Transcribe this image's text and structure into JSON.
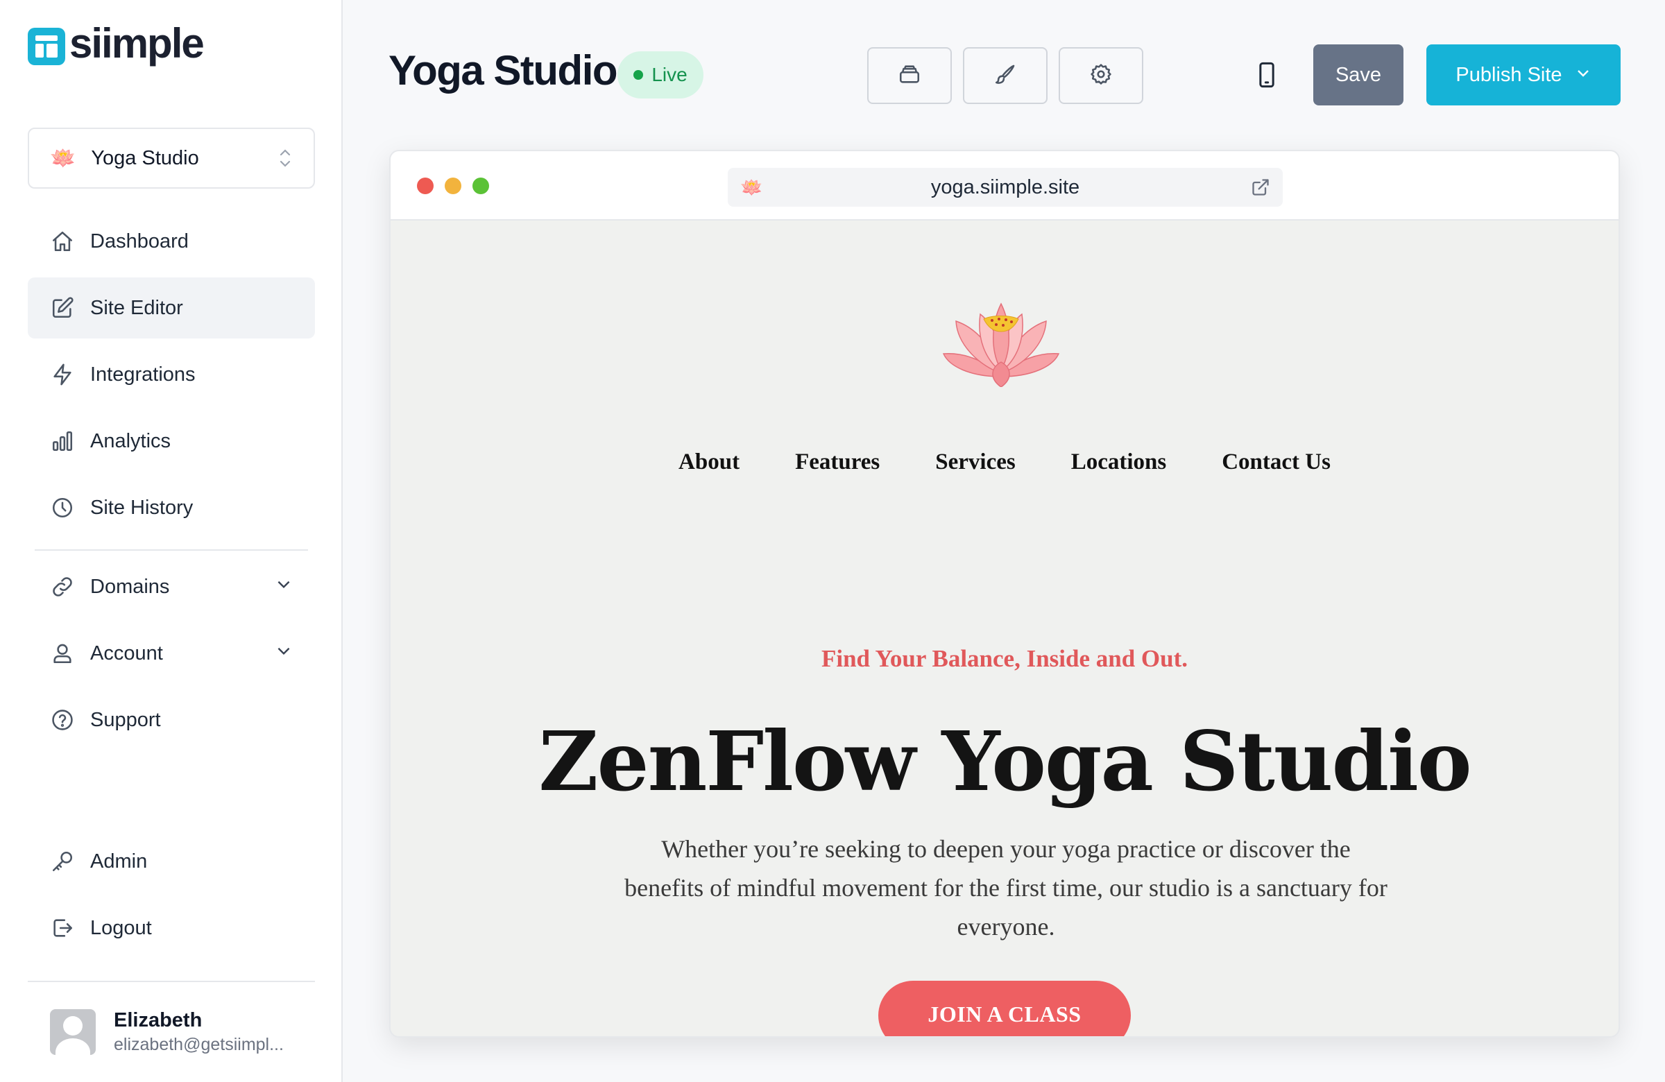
{
  "brand": {
    "name": "siimple",
    "color": "#1ab3d6"
  },
  "site_selector": {
    "icon": "lotus-icon",
    "name": "Yoga Studio"
  },
  "sidebar": {
    "items": [
      {
        "label": "Dashboard",
        "icon": "home-icon"
      },
      {
        "label": "Site Editor",
        "icon": "edit-icon",
        "active": true
      },
      {
        "label": "Integrations",
        "icon": "bolt-icon"
      },
      {
        "label": "Analytics",
        "icon": "bar-chart-icon"
      },
      {
        "label": "Site History",
        "icon": "clock-icon"
      }
    ],
    "groups": [
      {
        "label": "Domains",
        "icon": "link-icon"
      },
      {
        "label": "Account",
        "icon": "user-icon"
      },
      {
        "label": "Support",
        "icon": "help-icon"
      }
    ],
    "bottom": [
      {
        "label": "Admin",
        "icon": "key-icon"
      },
      {
        "label": "Logout",
        "icon": "logout-icon"
      }
    ]
  },
  "user": {
    "name": "Elizabeth",
    "email": "elizabeth@getsiimpl..."
  },
  "header": {
    "title": "Yoga Studio",
    "status": "Live",
    "save_label": "Save",
    "publish_label": "Publish Site"
  },
  "preview": {
    "url": "yoga.siimple.site",
    "nav": [
      "About",
      "Features",
      "Services",
      "Locations",
      "Contact Us"
    ],
    "tagline": "Find Your Balance, Inside and Out.",
    "title": "ZenFlow Yoga Studio",
    "subtitle": "Whether you’re seeking to deepen your yoga practice or discover the benefits of mindful movement for the first time, our studio is a sanctuary for everyone.",
    "cta": "JOIN A CLASS"
  },
  "colors": {
    "publish": "#16b3d7",
    "save": "#677387",
    "live_bg": "#d7f5e6",
    "live_text": "#15924e",
    "tagline": "#e0585a",
    "cta": "#ee5f62"
  }
}
